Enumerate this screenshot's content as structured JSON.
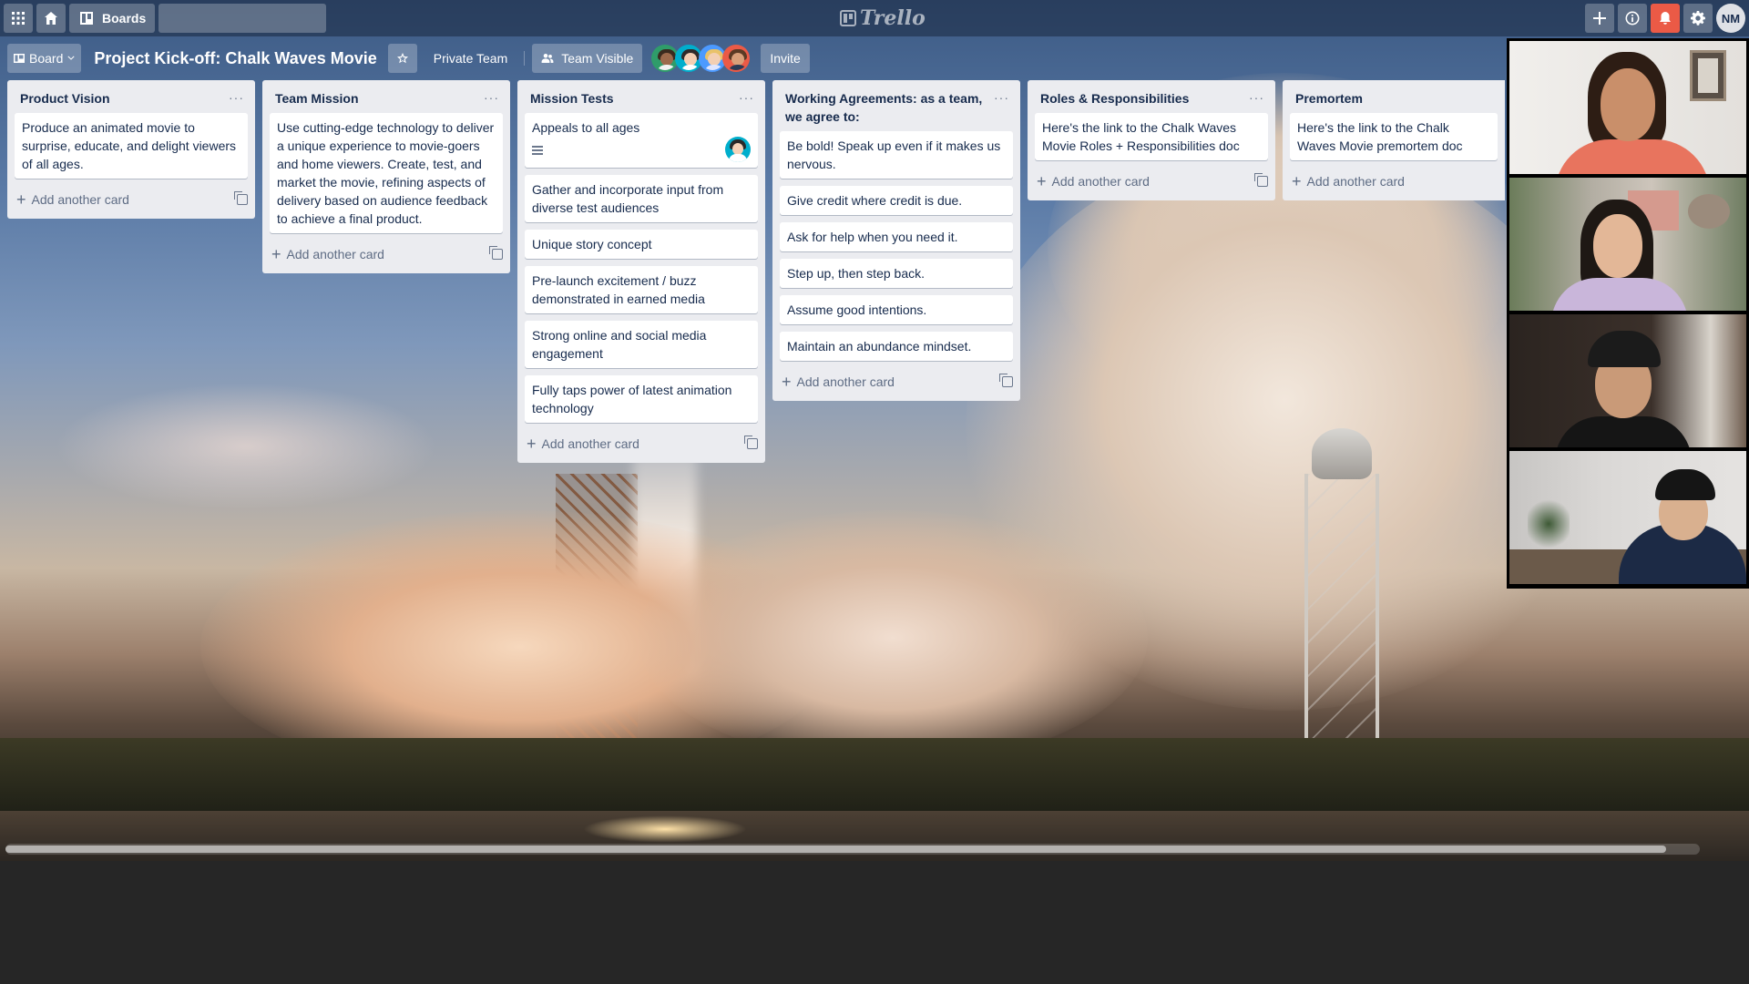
{
  "topbar": {
    "boards_label": "Boards",
    "search_placeholder": "",
    "logo_text": "Trello",
    "user_initials": "NM",
    "bell_color": "#eb5a46"
  },
  "board": {
    "view_label": "Board",
    "title": "Project Kick-off: Chalk Waves Movie",
    "team_label": "Private Team",
    "visibility_label": "Team Visible",
    "invite_label": "Invite",
    "member_colors": [
      "#00aecc",
      "#00aecc",
      "#4c9aff",
      "#eb5a46"
    ]
  },
  "lists": [
    {
      "title": "Product Vision",
      "cards": [
        {
          "text": "Produce an animated movie to surprise, educate, and delight viewers of all ages."
        }
      ],
      "add_label": "Add another card"
    },
    {
      "title": "Team Mission",
      "cards": [
        {
          "text": "Use cutting-edge technology to deliver a unique experience to movie-goers and home viewers. Create, test, and market the movie, refining aspects of delivery based on audience feedback to achieve a final product."
        }
      ],
      "add_label": "Add another card"
    },
    {
      "title": "Mission Tests",
      "cards": [
        {
          "text": "Appeals to all ages",
          "has_description": true,
          "has_member": true
        },
        {
          "text": "Gather and incorporate input from diverse test audiences"
        },
        {
          "text": "Unique story concept"
        },
        {
          "text": "Pre-launch excitement / buzz demonstrated in earned media"
        },
        {
          "text": "Strong online and social media engagement"
        },
        {
          "text": "Fully taps power of latest animation technology"
        }
      ],
      "add_label": "Add another card"
    },
    {
      "title": "Working Agreements: as a team, we agree to:",
      "cards": [
        {
          "text": "Be bold! Speak up even if it makes us nervous."
        },
        {
          "text": "Give credit where credit is due."
        },
        {
          "text": "Ask for help when you need it."
        },
        {
          "text": "Step up, then step back."
        },
        {
          "text": "Assume good intentions."
        },
        {
          "text": "Maintain an abundance mindset."
        }
      ],
      "add_label": "Add another card"
    },
    {
      "title": "Roles & Responsibilities",
      "cards": [
        {
          "text": "Here's the link to the Chalk Waves Movie Roles + Responsibilities doc"
        }
      ],
      "add_label": "Add another card"
    },
    {
      "title": "Premortem",
      "cards": [
        {
          "text": "Here's the link to the Chalk Waves Movie premortem doc"
        }
      ],
      "add_label": "Add another card"
    }
  ],
  "video_call": {
    "participant_count": 4
  },
  "scrollbar": {
    "position_fraction": 0.0,
    "visible_fraction": 0.98
  }
}
